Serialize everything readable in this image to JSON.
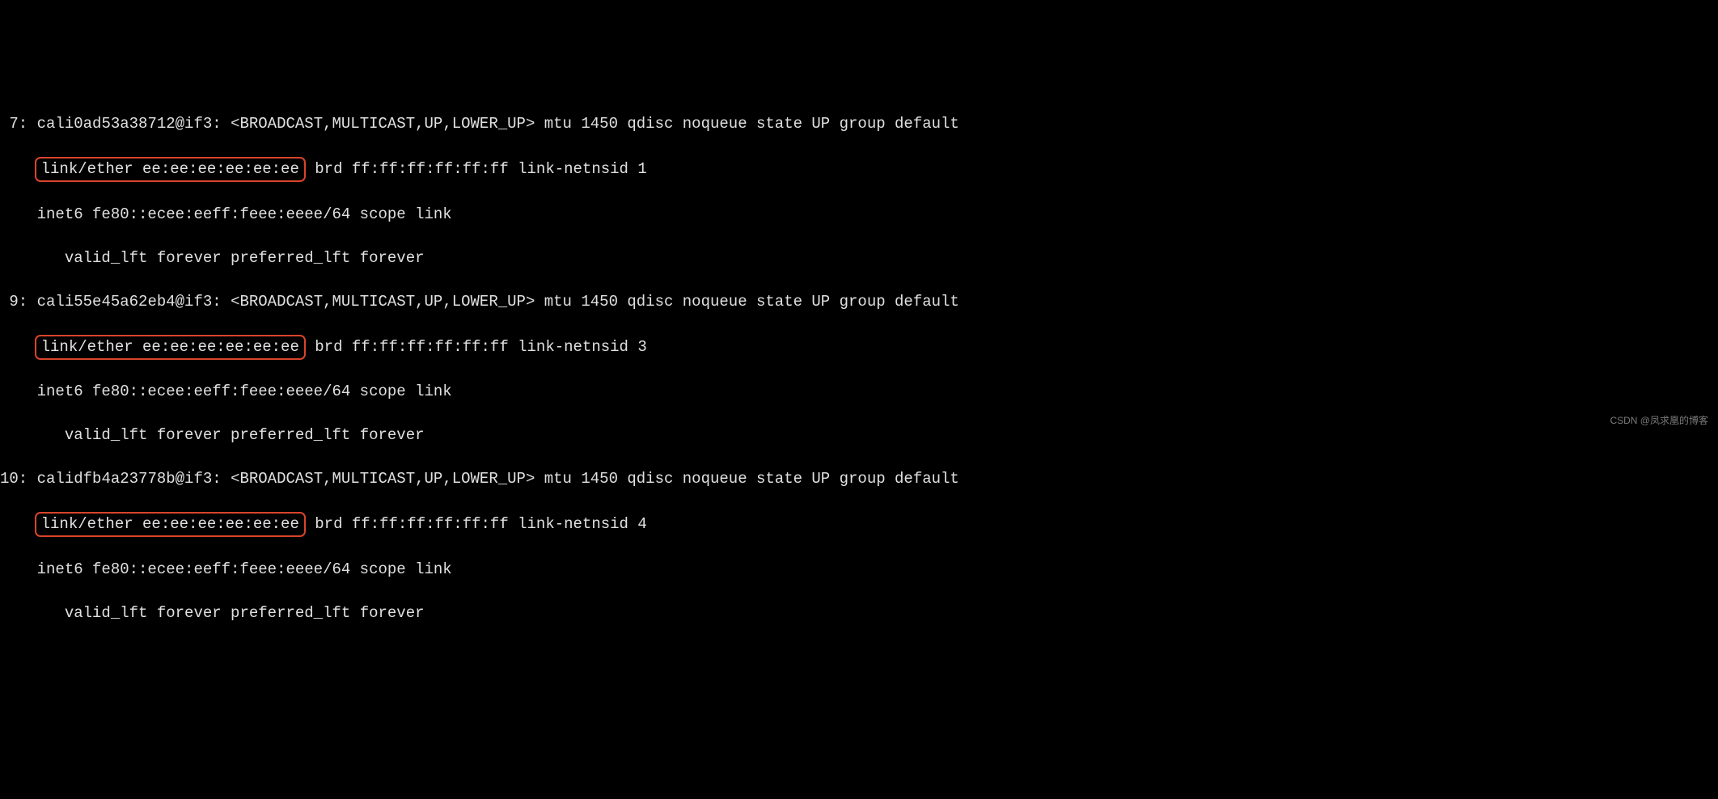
{
  "interfaces": [
    {
      "index": "7:",
      "name": "cali0ad53a38712@if3:",
      "flags": "<BROADCAST,MULTICAST,UP,LOWER_UP>",
      "params": "mtu 1450 qdisc noqueue state UP group default",
      "link_ether": "link/ether ee:ee:ee:ee:ee:ee",
      "brd": "brd ff:ff:ff:ff:ff:ff link-netnsid 1",
      "inet6": "inet6 fe80::ecee:eeff:feee:eeee/64 scope link",
      "valid": "valid_lft forever preferred_lft forever"
    },
    {
      "index": "9:",
      "name": "cali55e45a62eb4@if3:",
      "flags": "<BROADCAST,MULTICAST,UP,LOWER_UP>",
      "params": "mtu 1450 qdisc noqueue state UP group default",
      "link_ether": "link/ether ee:ee:ee:ee:ee:ee",
      "brd": "brd ff:ff:ff:ff:ff:ff link-netnsid 3",
      "inet6": "inet6 fe80::ecee:eeff:feee:eeee/64 scope link",
      "valid": "valid_lft forever preferred_lft forever"
    },
    {
      "index": "10:",
      "name": "calidfb4a23778b@if3:",
      "flags": "<BROADCAST,MULTICAST,UP,LOWER_UP>",
      "params": "mtu 1450 qdisc noqueue state UP group default",
      "link_ether": "link/ether ee:ee:ee:ee:ee:ee",
      "brd": "brd ff:ff:ff:ff:ff:ff link-netnsid 4",
      "inet6": "inet6 fe80::ecee:eeff:feee:eeee/64 scope link",
      "valid": "valid_lft forever preferred_lft forever"
    }
  ],
  "watermark": "CSDN @凤求凰的博客"
}
